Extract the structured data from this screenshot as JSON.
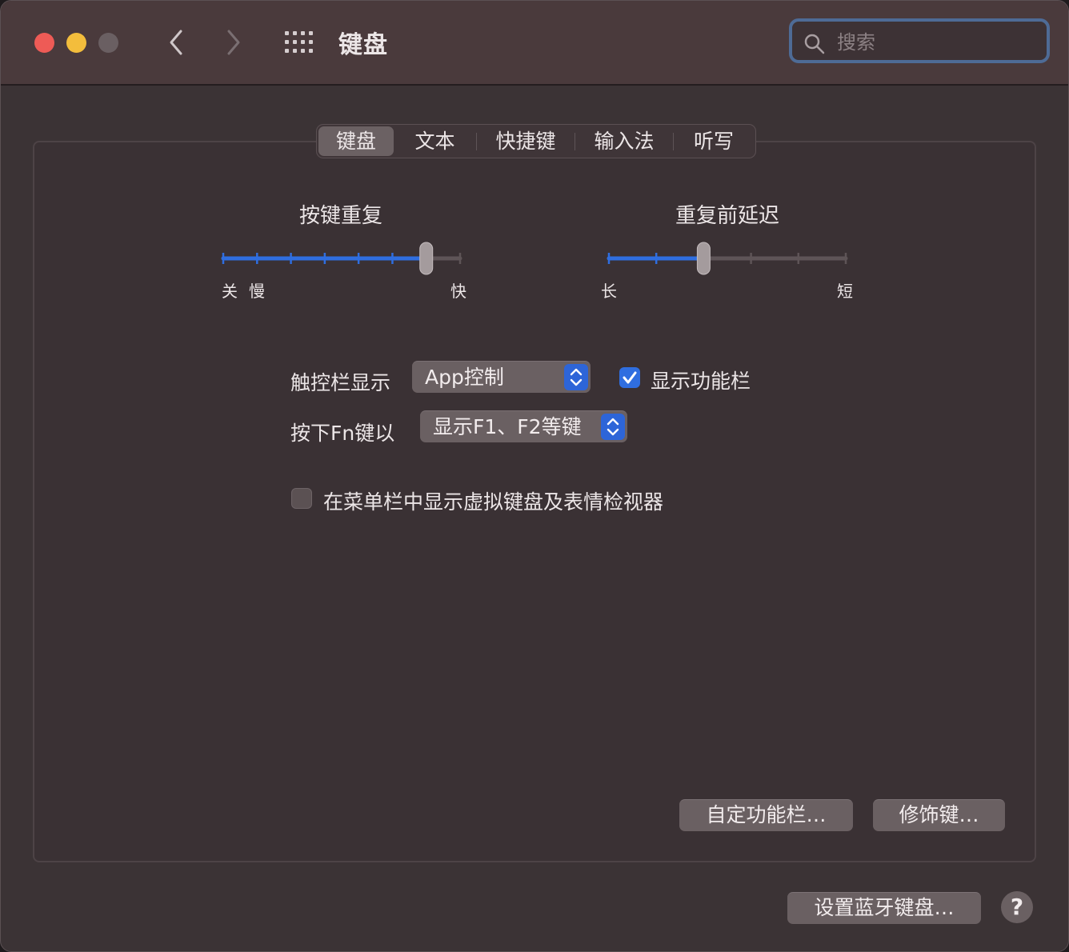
{
  "window": {
    "title": "键盘",
    "search_placeholder": "搜索"
  },
  "tabs": [
    {
      "label": "键盘",
      "active": true
    },
    {
      "label": "文本",
      "active": false
    },
    {
      "label": "快捷键",
      "active": false
    },
    {
      "label": "输入法",
      "active": false
    },
    {
      "label": "听写",
      "active": false
    }
  ],
  "key_repeat": {
    "title": "按键重复",
    "label_off": "关",
    "label_slow": "慢",
    "label_fast": "快",
    "ticks": 8,
    "value_index": 6
  },
  "delay_until_repeat": {
    "title": "重复前延迟",
    "label_long": "长",
    "label_short": "短",
    "ticks": 6,
    "value_index": 2
  },
  "touch_bar": {
    "label": "触控栏显示",
    "value": "App控制",
    "show_control_strip_label": "显示功能栏",
    "show_control_strip_checked": true
  },
  "fn_key": {
    "label": "按下Fn键以",
    "value": "显示F1、F2等键"
  },
  "menu_bar_viewer": {
    "label": "在菜单栏中显示虚拟键盘及表情检视器",
    "checked": false
  },
  "buttons": {
    "customize_control_strip": "自定功能栏…",
    "modifier_keys": "修饰键…",
    "setup_bluetooth_keyboard": "设置蓝牙键盘…",
    "help": "?"
  },
  "colors": {
    "accent": "#2f6ee0",
    "titlebar": "#4a3a3c",
    "background": "#3b3335"
  }
}
